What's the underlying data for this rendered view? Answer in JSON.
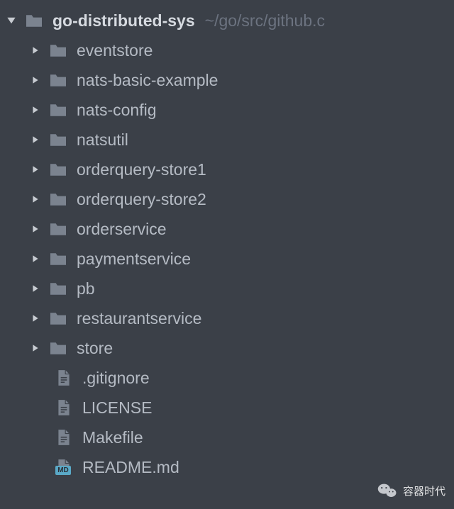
{
  "root": {
    "name": "go-distributed-sys",
    "path": "~/go/src/github.c"
  },
  "items": [
    {
      "type": "folder",
      "label": "eventstore"
    },
    {
      "type": "folder",
      "label": "nats-basic-example"
    },
    {
      "type": "folder",
      "label": "nats-config"
    },
    {
      "type": "folder",
      "label": "natsutil"
    },
    {
      "type": "folder",
      "label": "orderquery-store1"
    },
    {
      "type": "folder",
      "label": "orderquery-store2"
    },
    {
      "type": "folder",
      "label": "orderservice"
    },
    {
      "type": "folder",
      "label": "paymentservice"
    },
    {
      "type": "folder",
      "label": "pb"
    },
    {
      "type": "folder",
      "label": "restaurantservice"
    },
    {
      "type": "folder",
      "label": "store"
    },
    {
      "type": "file",
      "label": ".gitignore"
    },
    {
      "type": "file",
      "label": "LICENSE"
    },
    {
      "type": "file",
      "label": "Makefile"
    },
    {
      "type": "md",
      "label": "README.md"
    }
  ],
  "watermark": {
    "label": "容器时代"
  },
  "md_badge": "MD"
}
